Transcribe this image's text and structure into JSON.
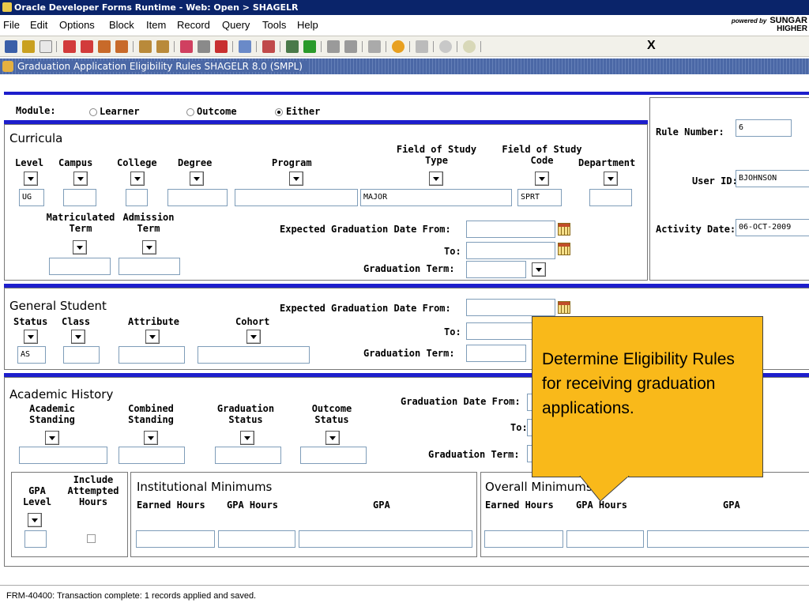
{
  "window": {
    "title": "Oracle Developer Forms Runtime - Web: Open > SHAGELR"
  },
  "menu": [
    "File",
    "Edit",
    "Options",
    "Block",
    "Item",
    "Record",
    "Query",
    "Tools",
    "Help"
  ],
  "brand": {
    "powered_by": "powered by",
    "name": "SUNGAR",
    "line2": "HIGHER"
  },
  "toolbar": {
    "exit_label": "X"
  },
  "form": {
    "title": "Graduation Application Eligibility Rules  SHAGELR 8.0  (SMPL)"
  },
  "module": {
    "label": "Module:",
    "options": [
      "Learner",
      "Outcome",
      "Either"
    ],
    "selected": "Either"
  },
  "curricula": {
    "title": "Curricula",
    "level": {
      "label": "Level",
      "value": "UG"
    },
    "campus": {
      "label": "Campus",
      "value": ""
    },
    "college": {
      "label": "College",
      "value": ""
    },
    "degree": {
      "label": "Degree",
      "value": ""
    },
    "program": {
      "label": "Program",
      "value": ""
    },
    "field_type": {
      "label1": "Field of Study",
      "label2": "Type",
      "value": "MAJOR"
    },
    "field_code": {
      "label1": "Field of Study",
      "label2": "Code",
      "value": "SPRT"
    },
    "department": {
      "label": "Department",
      "value": ""
    },
    "matric": {
      "label1": "Matriculated",
      "label2": "Term",
      "value": ""
    },
    "admission": {
      "label1": "Admission",
      "label2": "Term",
      "value": ""
    },
    "exp_from": {
      "label": "Expected Graduation Date From:",
      "value": ""
    },
    "exp_to": {
      "label": "To:",
      "value": ""
    },
    "grad_term": {
      "label": "Graduation Term:",
      "value": ""
    }
  },
  "rule": {
    "rule_number": {
      "label": "Rule Number:",
      "value": "6"
    },
    "user_id": {
      "label": "User ID:",
      "value": "BJOHNSON"
    },
    "activity_date": {
      "label": "Activity Date:",
      "value": "06-OCT-2009"
    }
  },
  "general": {
    "title": "General Student",
    "status": {
      "label": "Status",
      "value": "AS"
    },
    "class": {
      "label": "Class",
      "value": ""
    },
    "attribute": {
      "label": "Attribute",
      "value": ""
    },
    "cohort": {
      "label": "Cohort",
      "value": ""
    },
    "exp_from": {
      "label": "Expected Graduation Date From:"
    },
    "exp_to": {
      "label": "To:"
    },
    "grad_term": {
      "label": "Graduation Term:"
    }
  },
  "academic": {
    "title": "Academic History",
    "standing": {
      "label1": "Academic",
      "label2": "Standing"
    },
    "combined": {
      "label1": "Combined",
      "label2": "Standing"
    },
    "grad_status": {
      "label1": "Graduation",
      "label2": "Status"
    },
    "outcome": {
      "label1": "Outcome",
      "label2": "Status"
    },
    "date_from": {
      "label": "Graduation Date From:"
    },
    "date_to": {
      "label": "To:"
    },
    "grad_term": {
      "label": "Graduation Term:"
    }
  },
  "gpa": {
    "level": {
      "label1": "GPA",
      "label2": "Level"
    },
    "include": {
      "label1": "Include",
      "label2": "Attempted",
      "label3": "Hours"
    },
    "institutional": {
      "title": "Institutional Minimums",
      "earned": "Earned Hours",
      "gpa_hours": "GPA Hours",
      "gpa": "GPA"
    },
    "overall": {
      "title": "Overall Minimums",
      "earned": "Earned Hours",
      "gpa_hours": "GPA Hours",
      "gpa": "GPA"
    }
  },
  "callout": {
    "text": "Determine Eligibility Rules for receiving graduation applications."
  },
  "status": {
    "message": "FRM-40400: Transaction complete: 1 records applied and saved."
  }
}
